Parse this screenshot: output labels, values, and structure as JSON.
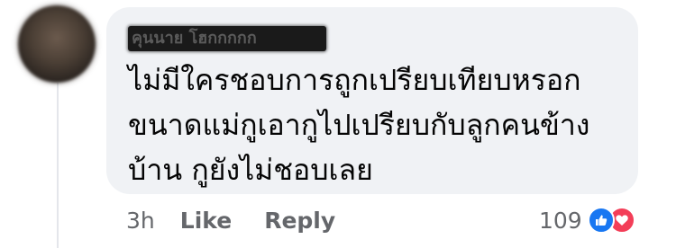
{
  "comment": {
    "author": "คุนนาย โฮกกกกก",
    "text_lines": [
      "ไม่มีใครชอบการถูกเปรียบเทียบหรอก",
      "ขนาดแม่กูเอากูไปเปรียบกับลูกคนข้าง",
      "บ้าน กูยังไม่ชอบเลย"
    ],
    "timestamp": "3h",
    "like_label": "Like",
    "reply_label": "Reply",
    "reaction_count": "109",
    "reaction_icons": [
      "like-icon",
      "love-icon"
    ]
  },
  "colors": {
    "bubble": "#f0f2f5",
    "meta_text": "#65676b",
    "like_blue": "#1877f2",
    "love_red": "#f33e58"
  }
}
